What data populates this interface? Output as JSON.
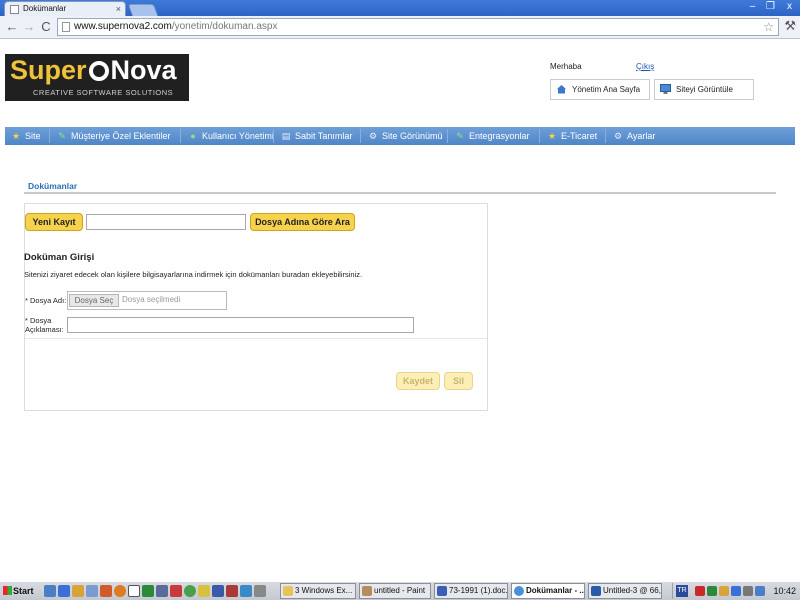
{
  "browser": {
    "tab_title": "Dokümanlar",
    "tab_close": "×",
    "url_host": "www.supernova2.com",
    "url_path": "/yonetim/dokuman.aspx",
    "back_icon": "←",
    "forward_icon": "→",
    "reload_icon": "C",
    "star_icon": "☆",
    "wrench_icon": "🔧",
    "min_icon": "–",
    "max_icon": "❐",
    "close_icon": "x"
  },
  "header": {
    "logo_word_1": "Super",
    "logo_word_2": "Nova",
    "logo_tagline": "CREATIVE SOFTWARE SOLUTIONS",
    "greeting": "Merhaba",
    "logout": "Çıkış",
    "admin_home": "Yönetim Ana Sayfa",
    "view_site": "Siteyi Görüntüle"
  },
  "menu": {
    "items": [
      {
        "label": "Site",
        "icon": "★"
      },
      {
        "label": "Müşteriye Özel Eklentiler",
        "icon": "✎"
      },
      {
        "label": "Kullanıcı Yönetimi",
        "icon": "●"
      },
      {
        "label": "Sabit Tanımlar",
        "icon": "▤"
      },
      {
        "label": "Site Görünümü",
        "icon": "⚙"
      },
      {
        "label": "Entegrasyonlar",
        "icon": "✎"
      },
      {
        "label": "E-Ticaret",
        "icon": "★"
      },
      {
        "label": "Ayarlar",
        "icon": "⚙"
      }
    ]
  },
  "page": {
    "section_title": "Dokümanlar",
    "new_record": "Yeni Kayıt",
    "search_value": "",
    "search_button": "Dosya Adına Göre Ara",
    "form_title": "Doküman Girişi",
    "form_desc": "Sitenizi ziyaret edecek olan kişilere bilgisayarlarına indirmek için dokümanları buradan ekleyebilirsiniz.",
    "file_label": "* Dosya Adı:",
    "file_button": "Dosya Seç",
    "file_status": "Dosya seçilmedi",
    "desc_label_1": "* Dosya",
    "desc_label_2": "Açıklaması:",
    "desc_value": "",
    "save": "Kaydet",
    "delete": "Sil"
  },
  "taskbar": {
    "start": "Start",
    "tasks": [
      {
        "label": "3 Windows Ex...",
        "color": "#e8c25a"
      },
      {
        "label": "untitled - Paint",
        "color": "#b58d5c"
      },
      {
        "label": "73-1991 (1).doc...",
        "color": "#3b5fb5"
      },
      {
        "label": "Dokümanlar - ...",
        "color": "#4a90d9"
      },
      {
        "label": "Untitled-3 @ 66,...",
        "color": "#2a5aa8"
      }
    ],
    "lang": "TR",
    "clock": "10:42"
  }
}
